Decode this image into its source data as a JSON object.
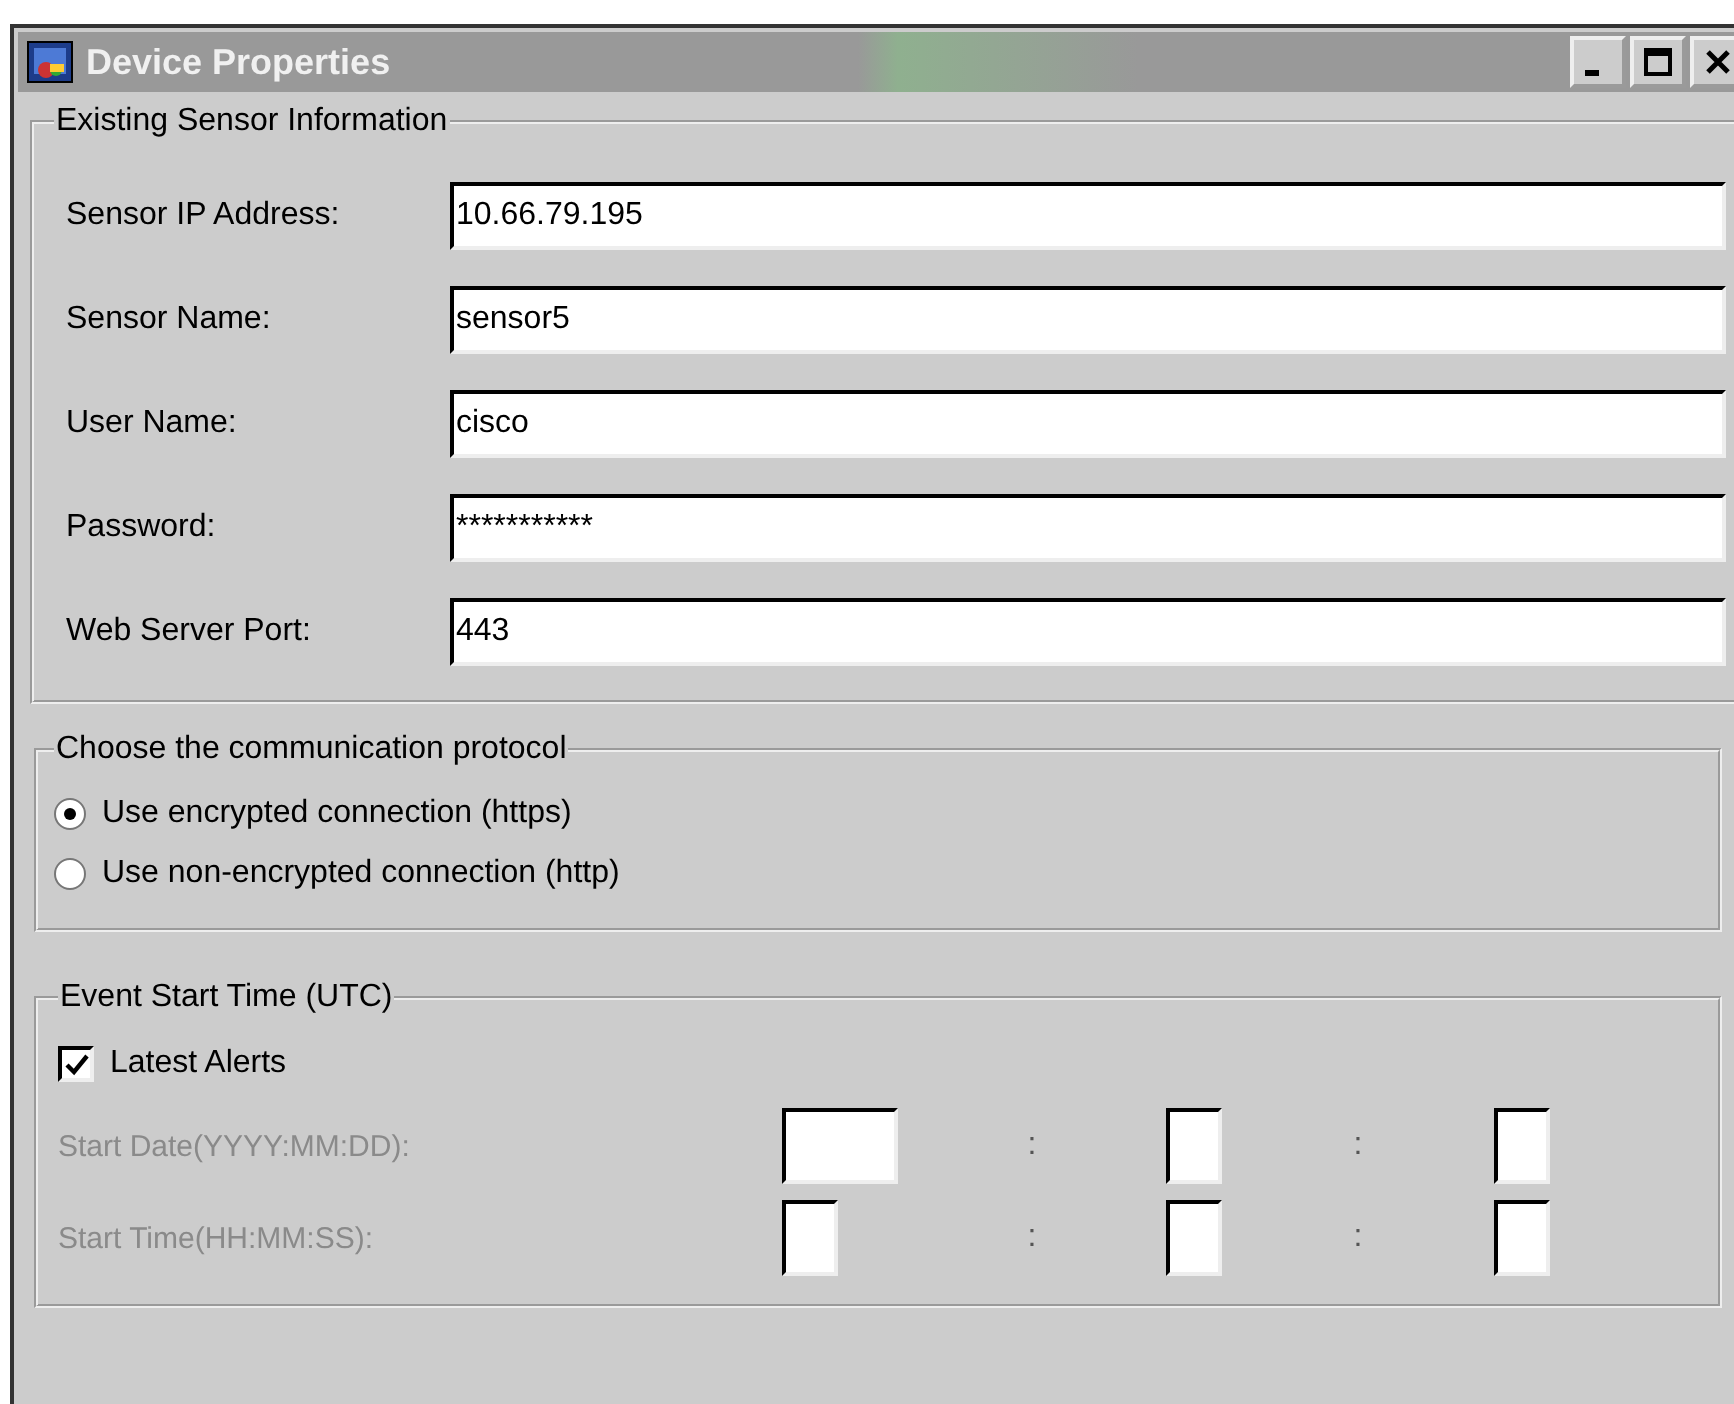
{
  "window": {
    "title": "Device Properties"
  },
  "sensor_information": {
    "title": "Existing Sensor Information",
    "fields": [
      {
        "label": "Sensor IP Address:",
        "value": "10.66.79.195"
      },
      {
        "label": "Sensor Name:",
        "value": "sensor5"
      },
      {
        "label": "User Name:",
        "value": "cisco"
      },
      {
        "label": "Password:",
        "value": "***********"
      },
      {
        "label": "Web Server Port:",
        "value": "443"
      }
    ]
  },
  "protocol": {
    "title": "Choose the communication protocol",
    "options": [
      {
        "label": "Use encrypted connection (https)",
        "selected": true
      },
      {
        "label": "Use non-encrypted connection (http)",
        "selected": false
      }
    ]
  },
  "event_start_time": {
    "title": "Event Start Time (UTC)",
    "latest_alerts": {
      "label": "Latest Alerts",
      "checked": true
    },
    "rows": [
      {
        "label": "Start Date(YYYY:MM:DD):",
        "disabled": true,
        "separators": [
          ":",
          ":"
        ],
        "fields": [
          {
            "kind": "wide"
          },
          {
            "kind": "narrow"
          },
          {
            "kind": "narrow"
          }
        ]
      },
      {
        "label": "Start Time(HH:MM:SS):",
        "disabled": true,
        "separators": [
          ":",
          ":"
        ],
        "fields": [
          {
            "kind": "narrow"
          },
          {
            "kind": "narrow"
          },
          {
            "kind": "narrow"
          }
        ]
      }
    ]
  }
}
